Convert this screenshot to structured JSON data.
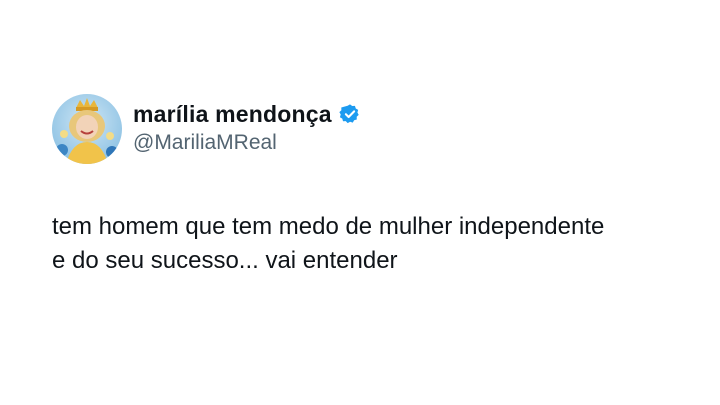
{
  "tweet": {
    "display_name": "marília mendonça",
    "handle": "@MariliaMReal",
    "verified_icon": "verified-badge-icon",
    "text_lines": [
      "tem homem que tem medo de mulher independente",
      "e do seu sucesso... vai entender"
    ]
  },
  "colors": {
    "verified": "#1d9bf0",
    "text": "#0f1419",
    "handle": "#536471",
    "background": "#ffffff"
  }
}
